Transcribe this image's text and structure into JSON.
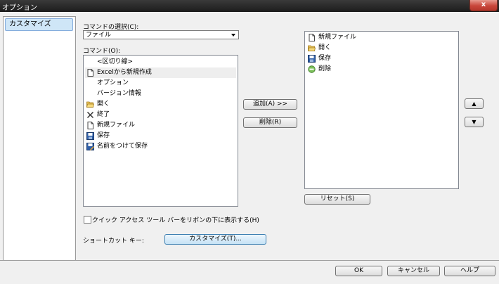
{
  "window": {
    "title": "オプション",
    "close_label": "x"
  },
  "nav": {
    "items": [
      {
        "label": "カスタマイズ"
      }
    ]
  },
  "commands": {
    "select_label": "コマンドの選択(C):",
    "category_value": "ファイル",
    "list_label": "コマンド(O):",
    "items": [
      {
        "label": "<区切り線>",
        "icon": ""
      },
      {
        "label": "Excelから新規作成",
        "icon": "new-file-icon"
      },
      {
        "label": "オプション",
        "icon": ""
      },
      {
        "label": "バージョン情報",
        "icon": ""
      },
      {
        "label": "開く",
        "icon": "folder-open-icon"
      },
      {
        "label": "終了",
        "icon": "close-x-icon"
      },
      {
        "label": "新規ファイル",
        "icon": "new-file-icon"
      },
      {
        "label": "保存",
        "icon": "save-icon"
      },
      {
        "label": "名前をつけて保存",
        "icon": "save-as-icon"
      }
    ]
  },
  "actions": {
    "add_label": "追加(A) >>",
    "remove_label": "削除(R)"
  },
  "toolbar_list": {
    "items": [
      {
        "label": "新規ファイル",
        "icon": "new-file-icon"
      },
      {
        "label": "開く",
        "icon": "folder-open-icon"
      },
      {
        "label": "保存",
        "icon": "save-icon"
      },
      {
        "label": "削除",
        "icon": "delete-icon"
      }
    ],
    "reset_label": "リセット(S)",
    "up_glyph": "▲",
    "down_glyph": "▼"
  },
  "options": {
    "show_below_ribbon_label": "クイック アクセス ツール バーをリボンの下に表示する(H)",
    "show_below_ribbon_checked": false,
    "shortcut_label": "ショートカット キー:",
    "customize_label": "カスタマイズ(T)..."
  },
  "footer": {
    "ok_label": "OK",
    "cancel_label": "キャンセル",
    "help_label": "ヘルプ"
  }
}
